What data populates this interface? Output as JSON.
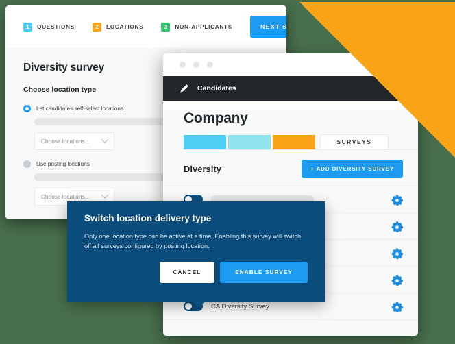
{
  "theme": {
    "background": "#49704e",
    "accent_blue": "#1c9bf0",
    "accent_orange": "#f9a317",
    "modal_blue": "#0a4c7c",
    "dark_header": "#22262a",
    "toggle_on": "#0d4f80"
  },
  "decor": {
    "triangle_color": "#f9a317"
  },
  "wizard": {
    "steps": [
      {
        "number": "1",
        "label": "QUESTIONS",
        "color": "#4ecdf5"
      },
      {
        "number": "2",
        "label": "LOCATIONS",
        "color": "#f9a317"
      },
      {
        "number": "3",
        "label": "NON-APPLICANTS",
        "color": "#2fc36d"
      }
    ],
    "next_step_label": "NEXT STEP",
    "title": "Diversity survey",
    "subtitle": "Choose location type",
    "options": [
      {
        "label": "Let candidates self-select locations",
        "selected": true,
        "select_placeholder": "Choose locations..."
      },
      {
        "label": "Use posting locations",
        "selected": false,
        "select_placeholder": "Choose locations..."
      }
    ]
  },
  "browser": {
    "window_dots": 3,
    "app_header": {
      "icon": "pencil-icon",
      "title": "Candidates"
    },
    "page_title": "Company",
    "tabs": [
      {
        "label": "",
        "color": "#4ecdf5"
      },
      {
        "label": "",
        "color": "#8ee3ec"
      },
      {
        "label": "",
        "color": "#f9a317"
      },
      {
        "label": "SURVEYS",
        "color": "#ffffff",
        "active": true
      }
    ],
    "section": {
      "title": "Diversity",
      "add_button_label": "+  ADD DIVERSITY SURVEY"
    },
    "surveys": [
      {
        "name": "",
        "skeleton": true,
        "toggle_on": false,
        "gear": "gear-icon"
      },
      {
        "name": "",
        "skeleton": true,
        "toggle_on": false,
        "gear": "gear-icon"
      },
      {
        "name": "",
        "skeleton": true,
        "toggle_on": false,
        "gear": "gear-icon"
      },
      {
        "name": "",
        "skeleton": true,
        "toggle_on": false,
        "gear": "gear-icon"
      },
      {
        "name": "CA Diversity Survey",
        "skeleton": false,
        "toggle_on": true,
        "gear": "gear-icon"
      }
    ]
  },
  "modal": {
    "title": "Switch location delivery type",
    "body": "Only one location type can be active at a time. Enabling this survey will switch off all surveys configured by posting location.",
    "cancel_label": "CANCEL",
    "confirm_label": "ENABLE SURVEY"
  }
}
